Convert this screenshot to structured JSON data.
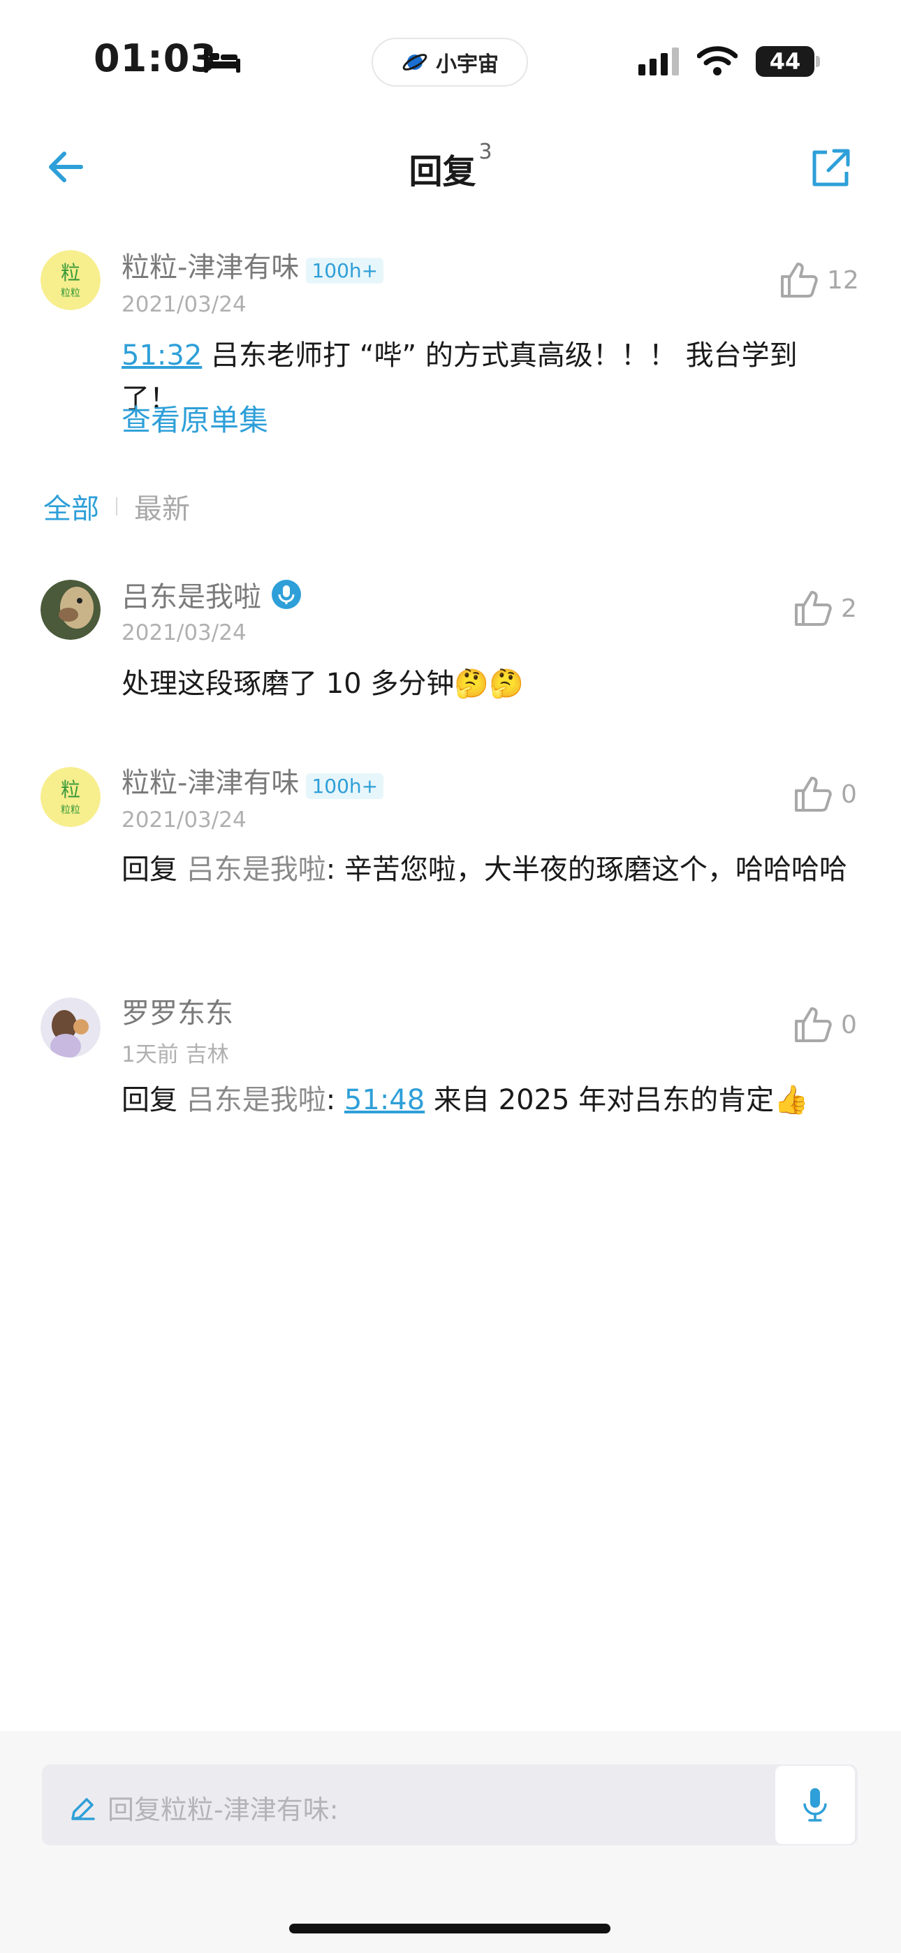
{
  "status_bar": {
    "time": "01:03",
    "battery": "44",
    "app_pill": "小宇宙"
  },
  "header": {
    "title": "回复",
    "count": "3"
  },
  "main_comment": {
    "author": "粒粒-津津有味",
    "badge": "100h+",
    "date": "2021/03/24",
    "timestamp": "51:32",
    "text": " 吕东老师打 “哔” 的方式真高级！！！ 我台学到了！",
    "likes": "12",
    "view_original": "查看原单集"
  },
  "tabs": {
    "all": "全部",
    "latest": "最新"
  },
  "replies": [
    {
      "author": "吕东是我啦",
      "date": "2021/03/24",
      "text": "处理这段琢磨了 10 多分钟🤔🤔",
      "likes": "2"
    },
    {
      "author": "粒粒-津津有味",
      "badge": "100h+",
      "date": "2021/03/24",
      "reply_prefix": "回复 ",
      "mention": "吕东是我啦",
      "text": ": 辛苦您啦，大半夜的琢磨这个，哈哈哈哈",
      "likes": "0"
    },
    {
      "author": "罗罗东东",
      "date": "1天前  吉林",
      "reply_prefix": "回复 ",
      "mention": "吕东是我啦",
      "text_before": ": ",
      "timestamp": "51:48",
      "text": " 来自 2025 年对吕东的肯定👍",
      "likes": "0"
    }
  ],
  "composer": {
    "placeholder": "回复粒粒-津津有味:"
  },
  "colors": {
    "accent": "#2e9fd8",
    "badge_bg": "#e7f6fb"
  },
  "icons": [
    "back-arrow-icon",
    "share-icon",
    "thumbs-up-icon",
    "mic-icon",
    "pencil-icon",
    "wifi-icon",
    "signal-icon",
    "bed-icon",
    "planet-icon"
  ]
}
